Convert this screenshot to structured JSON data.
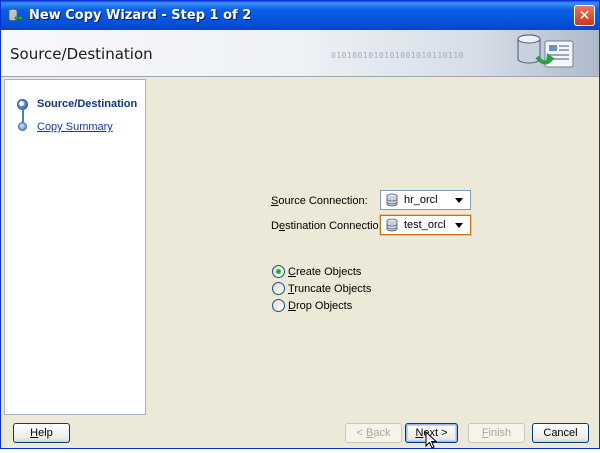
{
  "window": {
    "title": "New Copy Wizard - Step 1 of 2",
    "close_glyph": "✕"
  },
  "header": {
    "title": "Source/Destination",
    "decoration_text": "0101001010101001010110110"
  },
  "nav": {
    "items": [
      {
        "label": "Source/Destination",
        "state": "current"
      },
      {
        "label": "Copy Summary",
        "state": "link"
      }
    ]
  },
  "form": {
    "source_label_prefix": "",
    "source_label_mnemonic": "S",
    "source_label_rest": "ource Connection:",
    "source_value": "hr_orcl",
    "destination_label_prefix": "D",
    "destination_label_mnemonic": "e",
    "destination_label_rest": "stination Connection:",
    "destination_value": "test_orcl",
    "options": [
      {
        "mnemonic": "C",
        "rest": "reate Objects",
        "checked": true
      },
      {
        "mnemonic": "T",
        "rest": "runcate Objects",
        "checked": false
      },
      {
        "mnemonic": "D",
        "rest": "rop Objects",
        "checked": false
      }
    ]
  },
  "footer": {
    "help_mnemonic": "H",
    "help_rest": "elp",
    "back_prefix": "< ",
    "back_mnemonic": "B",
    "back_rest": "ack",
    "next_mnemonic": "N",
    "next_rest": "ext >",
    "finish_mnemonic": "F",
    "finish_rest": "inish",
    "cancel_label": "Cancel"
  },
  "icons": {
    "title": "wizard-app-icon",
    "header": "database-copy-icon",
    "db": "database-icon",
    "dropdown": "chevron-down-icon",
    "cursor": "mouse-pointer-icon"
  },
  "colors": {
    "titlebar": "#0553dc",
    "nav_active": "#13357d",
    "link": "#1839a6",
    "radio_checked": "#21a121"
  }
}
